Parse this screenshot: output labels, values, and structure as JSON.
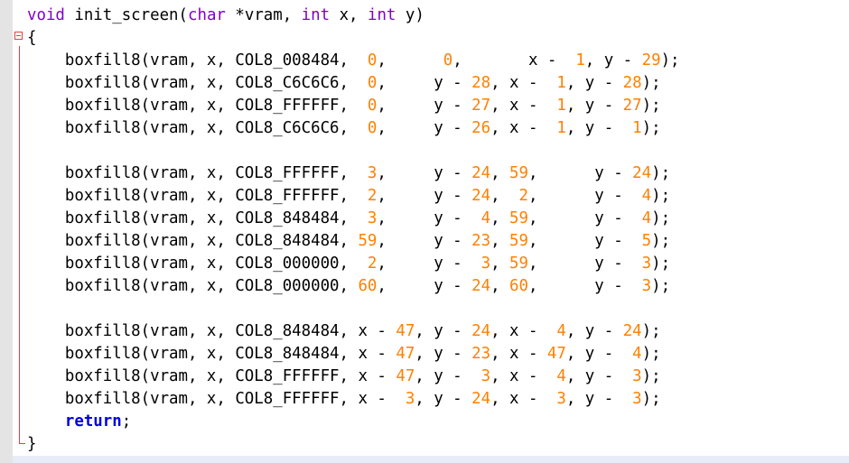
{
  "editor": {
    "language": "C",
    "colors": {
      "keyword": "#8000c8",
      "number": "#ff8000",
      "text": "#000000",
      "return_keyword": "#0000e0",
      "fold_marker": "#e04040",
      "gutter": "#e4e4e4",
      "current_line": "#e8ecf8"
    },
    "fold_icon": "fold-collapse-minus-icon",
    "lines": [
      [
        [
          "kw",
          "void"
        ],
        [
          "txt",
          " init_screen("
        ],
        [
          "kw",
          "char"
        ],
        [
          "txt",
          " *vram, "
        ],
        [
          "kw",
          "int"
        ],
        [
          "txt",
          " x, "
        ],
        [
          "kw",
          "int"
        ],
        [
          "txt",
          " y)"
        ]
      ],
      [
        [
          "txt",
          "{"
        ]
      ],
      [
        [
          "txt",
          "    boxfill8(vram, x, COL8_008484,  "
        ],
        [
          "num",
          "0"
        ],
        [
          "txt",
          ",      "
        ],
        [
          "num",
          "0"
        ],
        [
          "txt",
          ",       x -  "
        ],
        [
          "num",
          "1"
        ],
        [
          "txt",
          ", y - "
        ],
        [
          "num",
          "29"
        ],
        [
          "txt",
          ");"
        ]
      ],
      [
        [
          "txt",
          "    boxfill8(vram, x, COL8_C6C6C6,  "
        ],
        [
          "num",
          "0"
        ],
        [
          "txt",
          ",     y - "
        ],
        [
          "num",
          "28"
        ],
        [
          "txt",
          ", x -  "
        ],
        [
          "num",
          "1"
        ],
        [
          "txt",
          ", y - "
        ],
        [
          "num",
          "28"
        ],
        [
          "txt",
          ");"
        ]
      ],
      [
        [
          "txt",
          "    boxfill8(vram, x, COL8_FFFFFF,  "
        ],
        [
          "num",
          "0"
        ],
        [
          "txt",
          ",     y - "
        ],
        [
          "num",
          "27"
        ],
        [
          "txt",
          ", x -  "
        ],
        [
          "num",
          "1"
        ],
        [
          "txt",
          ", y - "
        ],
        [
          "num",
          "27"
        ],
        [
          "txt",
          ");"
        ]
      ],
      [
        [
          "txt",
          "    boxfill8(vram, x, COL8_C6C6C6,  "
        ],
        [
          "num",
          "0"
        ],
        [
          "txt",
          ",     y - "
        ],
        [
          "num",
          "26"
        ],
        [
          "txt",
          ", x -  "
        ],
        [
          "num",
          "1"
        ],
        [
          "txt",
          ", y -  "
        ],
        [
          "num",
          "1"
        ],
        [
          "txt",
          ");"
        ]
      ],
      [],
      [
        [
          "txt",
          "    boxfill8(vram, x, COL8_FFFFFF,  "
        ],
        [
          "num",
          "3"
        ],
        [
          "txt",
          ",     y - "
        ],
        [
          "num",
          "24"
        ],
        [
          "txt",
          ", "
        ],
        [
          "num",
          "59"
        ],
        [
          "txt",
          ",      y - "
        ],
        [
          "num",
          "24"
        ],
        [
          "txt",
          ");"
        ]
      ],
      [
        [
          "txt",
          "    boxfill8(vram, x, COL8_FFFFFF,  "
        ],
        [
          "num",
          "2"
        ],
        [
          "txt",
          ",     y - "
        ],
        [
          "num",
          "24"
        ],
        [
          "txt",
          ",  "
        ],
        [
          "num",
          "2"
        ],
        [
          "txt",
          ",      y -  "
        ],
        [
          "num",
          "4"
        ],
        [
          "txt",
          ");"
        ]
      ],
      [
        [
          "txt",
          "    boxfill8(vram, x, COL8_848484,  "
        ],
        [
          "num",
          "3"
        ],
        [
          "txt",
          ",     y -  "
        ],
        [
          "num",
          "4"
        ],
        [
          "txt",
          ", "
        ],
        [
          "num",
          "59"
        ],
        [
          "txt",
          ",      y -  "
        ],
        [
          "num",
          "4"
        ],
        [
          "txt",
          ");"
        ]
      ],
      [
        [
          "txt",
          "    boxfill8(vram, x, COL8_848484, "
        ],
        [
          "num",
          "59"
        ],
        [
          "txt",
          ",     y - "
        ],
        [
          "num",
          "23"
        ],
        [
          "txt",
          ", "
        ],
        [
          "num",
          "59"
        ],
        [
          "txt",
          ",      y -  "
        ],
        [
          "num",
          "5"
        ],
        [
          "txt",
          ");"
        ]
      ],
      [
        [
          "txt",
          "    boxfill8(vram, x, COL8_000000,  "
        ],
        [
          "num",
          "2"
        ],
        [
          "txt",
          ",     y -  "
        ],
        [
          "num",
          "3"
        ],
        [
          "txt",
          ", "
        ],
        [
          "num",
          "59"
        ],
        [
          "txt",
          ",      y -  "
        ],
        [
          "num",
          "3"
        ],
        [
          "txt",
          ");"
        ]
      ],
      [
        [
          "txt",
          "    boxfill8(vram, x, COL8_000000, "
        ],
        [
          "num",
          "60"
        ],
        [
          "txt",
          ",     y - "
        ],
        [
          "num",
          "24"
        ],
        [
          "txt",
          ", "
        ],
        [
          "num",
          "60"
        ],
        [
          "txt",
          ",      y -  "
        ],
        [
          "num",
          "3"
        ],
        [
          "txt",
          ");"
        ]
      ],
      [],
      [
        [
          "txt",
          "    boxfill8(vram, x, COL8_848484, x - "
        ],
        [
          "num",
          "47"
        ],
        [
          "txt",
          ", y - "
        ],
        [
          "num",
          "24"
        ],
        [
          "txt",
          ", x -  "
        ],
        [
          "num",
          "4"
        ],
        [
          "txt",
          ", y - "
        ],
        [
          "num",
          "24"
        ],
        [
          "txt",
          ");"
        ]
      ],
      [
        [
          "txt",
          "    boxfill8(vram, x, COL8_848484, x - "
        ],
        [
          "num",
          "47"
        ],
        [
          "txt",
          ", y - "
        ],
        [
          "num",
          "23"
        ],
        [
          "txt",
          ", x - "
        ],
        [
          "num",
          "47"
        ],
        [
          "txt",
          ", y -  "
        ],
        [
          "num",
          "4"
        ],
        [
          "txt",
          ");"
        ]
      ],
      [
        [
          "txt",
          "    boxfill8(vram, x, COL8_FFFFFF, x - "
        ],
        [
          "num",
          "47"
        ],
        [
          "txt",
          ", y -  "
        ],
        [
          "num",
          "3"
        ],
        [
          "txt",
          ", x -  "
        ],
        [
          "num",
          "4"
        ],
        [
          "txt",
          ", y -  "
        ],
        [
          "num",
          "3"
        ],
        [
          "txt",
          ");"
        ]
      ],
      [
        [
          "txt",
          "    boxfill8(vram, x, COL8_FFFFFF, x -  "
        ],
        [
          "num",
          "3"
        ],
        [
          "txt",
          ", y - "
        ],
        [
          "num",
          "24"
        ],
        [
          "txt",
          ", x -  "
        ],
        [
          "num",
          "3"
        ],
        [
          "txt",
          ", y -  "
        ],
        [
          "num",
          "3"
        ],
        [
          "txt",
          ");"
        ]
      ],
      [
        [
          "txt",
          "    "
        ],
        [
          "ret",
          "return"
        ],
        [
          "txt",
          ";"
        ]
      ],
      [
        [
          "txt",
          "}"
        ]
      ]
    ]
  }
}
